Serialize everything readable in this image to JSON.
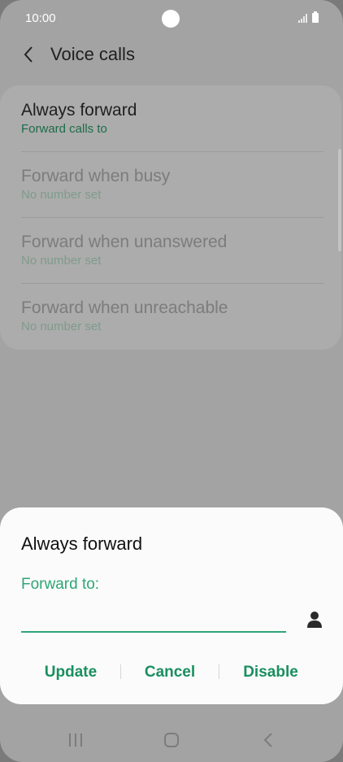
{
  "status_bar": {
    "time": "10:00"
  },
  "app_bar": {
    "title": "Voice calls"
  },
  "list": {
    "items": [
      {
        "primary": "Always forward",
        "secondary": "Forward calls to"
      },
      {
        "primary": "Forward when busy",
        "secondary": "No number set"
      },
      {
        "primary": "Forward when unanswered",
        "secondary": "No number set"
      },
      {
        "primary": "Forward when unreachable",
        "secondary": "No number set"
      }
    ]
  },
  "dialog": {
    "title": "Always forward",
    "field_label": "Forward to:",
    "field_value": "",
    "buttons": {
      "update": "Update",
      "cancel": "Cancel",
      "disable": "Disable"
    }
  },
  "icons": {
    "back": "chevron-left-icon",
    "contact": "person-icon",
    "nav_recents": "recents-icon",
    "nav_home": "home-icon",
    "nav_back": "back-icon"
  },
  "colors": {
    "accent": "#2fa577",
    "accent_dark": "#1a8f60",
    "overlay": "#a3a3a3"
  }
}
